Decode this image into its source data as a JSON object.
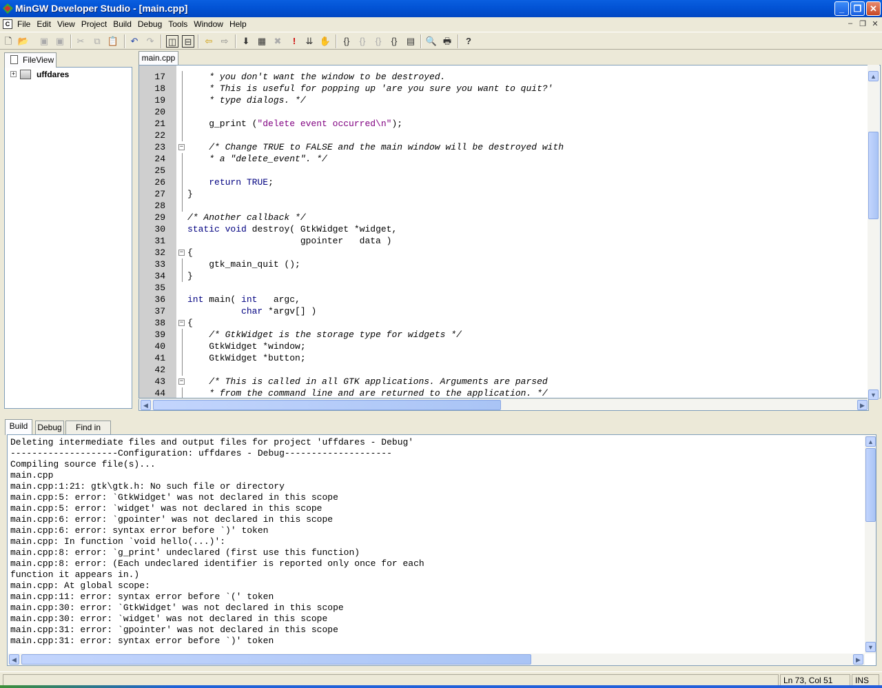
{
  "window": {
    "title": "MinGW Developer Studio - [main.cpp]"
  },
  "menu": {
    "mdi_icon": "C",
    "items": [
      "File",
      "Edit",
      "View",
      "Project",
      "Build",
      "Debug",
      "Tools",
      "Window",
      "Help"
    ]
  },
  "toolbar": {
    "icons": [
      "new-file",
      "open",
      "save",
      "save-all",
      "cut",
      "copy",
      "paste",
      "undo",
      "redo",
      "workspace",
      "output",
      "back",
      "forward",
      "compile",
      "build",
      "stop-build",
      "execute",
      "build-execute",
      "go",
      "step-into",
      "step-over",
      "step-out",
      "run-to-cursor",
      "breakpoints",
      "print-preview",
      "print",
      "help"
    ]
  },
  "fileview": {
    "tab_label": "FileView",
    "project": "uffdares"
  },
  "editor": {
    "tab": "main.cpp",
    "lines": [
      {
        "n": "17",
        "code": "    * you don't want the window to be destroyed.",
        "kind": "com",
        "fold": "line"
      },
      {
        "n": "18",
        "code": "    * This is useful for popping up 'are you sure you want to quit?'",
        "kind": "com",
        "fold": "line"
      },
      {
        "n": "19",
        "code": "    * type dialogs. */",
        "kind": "com",
        "fold": "line"
      },
      {
        "n": "20",
        "code": "",
        "kind": "",
        "fold": "line"
      },
      {
        "n": "21",
        "code": "    g_print (\"delete event occurred\\n\");",
        "kind": "mixed",
        "fold": "line"
      },
      {
        "n": "22",
        "code": "",
        "kind": "",
        "fold": "line"
      },
      {
        "n": "23",
        "code": "    /* Change TRUE to FALSE and the main window will be destroyed with",
        "kind": "com",
        "fold": "box"
      },
      {
        "n": "24",
        "code": "    * a \"delete_event\". */",
        "kind": "com",
        "fold": "line"
      },
      {
        "n": "25",
        "code": "",
        "kind": "",
        "fold": "line"
      },
      {
        "n": "26",
        "code": "    return TRUE;",
        "kind": "kw",
        "fold": "line"
      },
      {
        "n": "27",
        "code": "}",
        "kind": "kw",
        "fold": "line"
      },
      {
        "n": "28",
        "code": "",
        "kind": "",
        "fold": "line"
      },
      {
        "n": "29",
        "code": "/* Another callback */",
        "kind": "com",
        "fold": ""
      },
      {
        "n": "30",
        "code": "static void destroy( GtkWidget *widget,",
        "kind": "mixed",
        "fold": ""
      },
      {
        "n": "31",
        "code": "                     gpointer   data )",
        "kind": "",
        "fold": ""
      },
      {
        "n": "32",
        "code": "{",
        "kind": "kw",
        "fold": "box"
      },
      {
        "n": "33",
        "code": "    gtk_main_quit ();",
        "kind": "",
        "fold": "line"
      },
      {
        "n": "34",
        "code": "}",
        "kind": "kw",
        "fold": "line"
      },
      {
        "n": "35",
        "code": "",
        "kind": "",
        "fold": ""
      },
      {
        "n": "36",
        "code": "int main( int   argc,",
        "kind": "mixed",
        "fold": ""
      },
      {
        "n": "37",
        "code": "          char *argv[] )",
        "kind": "mixed",
        "fold": ""
      },
      {
        "n": "38",
        "code": "{",
        "kind": "kw",
        "fold": "box"
      },
      {
        "n": "39",
        "code": "    /* GtkWidget is the storage type for widgets */",
        "kind": "com",
        "fold": "line"
      },
      {
        "n": "40",
        "code": "    GtkWidget *window;",
        "kind": "",
        "fold": "line"
      },
      {
        "n": "41",
        "code": "    GtkWidget *button;",
        "kind": "",
        "fold": "line"
      },
      {
        "n": "42",
        "code": "",
        "kind": "",
        "fold": "line"
      },
      {
        "n": "43",
        "code": "    /* This is called in all GTK applications. Arguments are parsed",
        "kind": "com",
        "fold": "box"
      },
      {
        "n": "44",
        "code": "    * from the command line and are returned to the application. */",
        "kind": "com",
        "fold": "line"
      }
    ]
  },
  "output": {
    "tabs": [
      "Build",
      "Debug",
      "Find in Files"
    ],
    "lines": [
      "Deleting intermediate files and output files for project 'uffdares - Debug'",
      "--------------------Configuration: uffdares - Debug--------------------",
      "Compiling source file(s)...",
      "main.cpp",
      "main.cpp:1:21: gtk\\gtk.h: No such file or directory",
      "main.cpp:5: error: `GtkWidget' was not declared in this scope",
      "main.cpp:5: error: `widget' was not declared in this scope",
      "main.cpp:6: error: `gpointer' was not declared in this scope",
      "main.cpp:6: error: syntax error before `)' token",
      "main.cpp: In function `void hello(...)':",
      "main.cpp:8: error: `g_print' undeclared (first use this function)",
      "main.cpp:8: error: (Each undeclared identifier is reported only once for each",
      "function it appears in.)",
      "main.cpp: At global scope:",
      "main.cpp:11: error: syntax error before `(' token",
      "main.cpp:30: error: `GtkWidget' was not declared in this scope",
      "main.cpp:30: error: `widget' was not declared in this scope",
      "main.cpp:31: error: `gpointer' was not declared in this scope",
      "main.cpp:31: error: syntax error before `)' token"
    ]
  },
  "status": {
    "position": "Ln 73, Col 51",
    "mode": "INS"
  },
  "colors": {
    "comment": "#008000",
    "keyword": "#000080",
    "string": "#800080",
    "titlebar": "#0354d6"
  }
}
